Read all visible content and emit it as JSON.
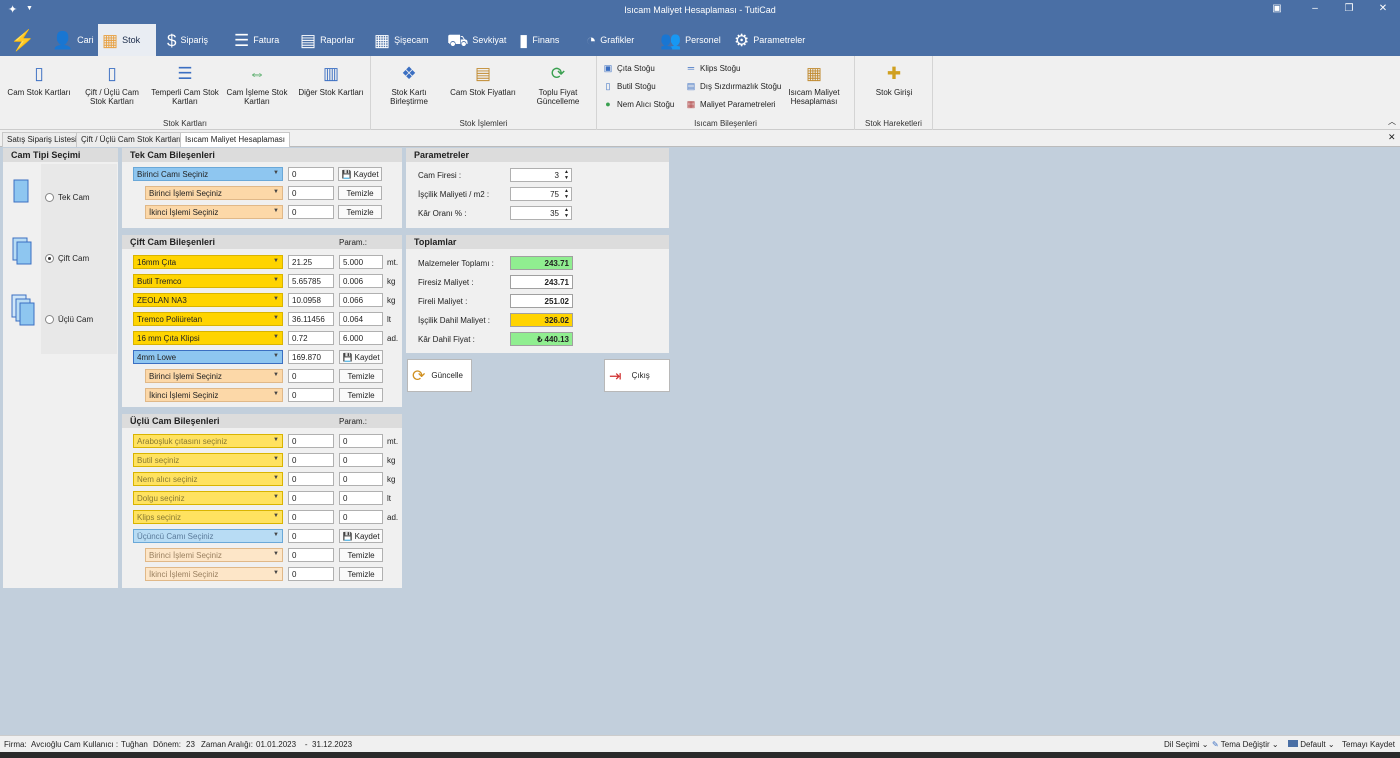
{
  "window": {
    "title": "Isıcam Maliyet Hesaplaması - TutiCad"
  },
  "menu": {
    "items": [
      {
        "label": "Cari",
        "icon": "user-icon"
      },
      {
        "label": "Stok",
        "icon": "box-icon"
      },
      {
        "label": "Sipariş",
        "icon": "order-icon"
      },
      {
        "label": "Fatura",
        "icon": "invoice-icon"
      },
      {
        "label": "Raporlar",
        "icon": "report-icon"
      },
      {
        "label": "Şişecam",
        "icon": "grid-icon"
      },
      {
        "label": "Sevkiyat",
        "icon": "truck-icon"
      },
      {
        "label": "Finans",
        "icon": "bar-chart-icon"
      },
      {
        "label": "Grafikler",
        "icon": "pie-chart-icon"
      },
      {
        "label": "Personel",
        "icon": "people-icon"
      },
      {
        "label": "Parametreler",
        "icon": "gear-icon"
      }
    ]
  },
  "ribbon": {
    "stok_kartlari": {
      "title": "Stok Kartları",
      "buttons": [
        "Cam Stok Kartları",
        "Çift / Üçlü Cam Stok Kartları",
        "Temperli Cam Stok Kartları",
        "Cam İşleme Stok Kartları",
        "Diğer Stok Kartları"
      ]
    },
    "stok_islemleri": {
      "title": "Stok İşlemleri",
      "buttons": [
        "Stok Kartı Birleştirme",
        "Cam Stok Fiyatları",
        "Toplu Fiyat Güncelleme"
      ]
    },
    "isicam": {
      "title": "Isıcam Bileşenleri",
      "small_left": [
        "Çıta Stoğu",
        "Butil Stoğu",
        "Nem Alıcı Stoğu"
      ],
      "small_right": [
        "Klips Stoğu",
        "Dış Sızdırmazlık Stoğu",
        "Maliyet Parametreleri"
      ],
      "big": "Isıcam Maliyet Hesaplaması"
    },
    "stok_hareketleri": {
      "title": "Stok Hareketleri",
      "buttons": [
        "Stok Girişi"
      ]
    }
  },
  "tabs": [
    "Satış Sipariş Listesi",
    "Çift / Üçlü Cam Stok Kartları",
    "Isıcam Maliyet Hesaplaması"
  ],
  "cam_tipi": {
    "title": "Cam Tipi Seçimi",
    "options": [
      {
        "label": "Tek Cam",
        "selected": false
      },
      {
        "label": "Çift Cam",
        "selected": true
      },
      {
        "label": "Üçlü Cam",
        "selected": false
      }
    ]
  },
  "tek_cam": {
    "title": "Tek Cam Bileşenleri",
    "glass": {
      "combo": "Birinci Camı Seçiniz",
      "value": "0",
      "button": "Kaydet"
    },
    "process1": {
      "combo": "Birinci İşlemi Seçiniz",
      "value": "0",
      "button": "Temizle"
    },
    "process2": {
      "combo": "İkinci İşlemi Seçiniz",
      "value": "0",
      "button": "Temizle"
    }
  },
  "cift_cam": {
    "title": "Çift Cam Bileşenleri",
    "param_label": "Param.:",
    "rows": [
      {
        "combo": "16mm Çıta",
        "value": "21.25",
        "param": "5.000",
        "unit": "mt."
      },
      {
        "combo": "Butil Tremco",
        "value": "5.65785",
        "param": "0.006",
        "unit": "kg"
      },
      {
        "combo": "ZEOLAN NA3",
        "value": "10.0958",
        "param": "0.066",
        "unit": "kg"
      },
      {
        "combo": "Tremco Poliüretan",
        "value": "36.11456",
        "param": "0.064",
        "unit": "lt"
      },
      {
        "combo": "16 mm Çıta Klipsi",
        "value": "0.72",
        "param": "6.000",
        "unit": "ad."
      }
    ],
    "glass": {
      "combo": "4mm Lowe",
      "value": "169.870",
      "button": "Kaydet"
    },
    "process1": {
      "combo": "Birinci İşlemi Seçiniz",
      "value": "0",
      "button": "Temizle"
    },
    "process2": {
      "combo": "İkinci İşlemi Seçiniz",
      "value": "0",
      "button": "Temizle"
    }
  },
  "uclu_cam": {
    "title": "Üçlü Cam Bileşenleri",
    "param_label": "Param.:",
    "rows": [
      {
        "combo": "Araboşluk çıtasını seçiniz",
        "value": "0",
        "param": "0",
        "unit": "mt."
      },
      {
        "combo": "Butil seçiniz",
        "value": "0",
        "param": "0",
        "unit": "kg"
      },
      {
        "combo": "Nem alıcı seçiniz",
        "value": "0",
        "param": "0",
        "unit": "kg"
      },
      {
        "combo": "Dolgu seçiniz",
        "value": "0",
        "param": "0",
        "unit": "lt"
      },
      {
        "combo": "Klips seçiniz",
        "value": "0",
        "param": "0",
        "unit": "ad."
      }
    ],
    "glass": {
      "combo": "Üçüncü Camı Seçiniz",
      "value": "0",
      "button": "Kaydet"
    },
    "process1": {
      "combo": "Birinci İşlemi Seçiniz",
      "value": "0",
      "button": "Temizle"
    },
    "process2": {
      "combo": "İkinci İşlemi Seçiniz",
      "value": "0",
      "button": "Temizle"
    }
  },
  "parametreler": {
    "title": "Parametreler",
    "rows": [
      {
        "label": "Cam Firesi :",
        "value": "3"
      },
      {
        "label": "İşçilik Maliyeti / m2 :",
        "value": "75"
      },
      {
        "label": "Kâr Oranı % :",
        "value": "35"
      }
    ]
  },
  "toplamlar": {
    "title": "Toplamlar",
    "rows": [
      {
        "label": "Malzemeler Toplamı :",
        "value": "243.71"
      },
      {
        "label": "Firesiz Maliyet :",
        "value": "243.71"
      },
      {
        "label": "Fireli Maliyet :",
        "value": "251.02"
      },
      {
        "label": "İşçilik Dahil Maliyet :",
        "value": "326.02"
      },
      {
        "label": "Kâr Dahil Fiyat :",
        "value": "₺ 440.13"
      }
    ]
  },
  "actions": {
    "update": "Güncelle",
    "exit": "Çıkış"
  },
  "status": {
    "firma_label": "Firma:",
    "firma": "Avcıoğlu Cam",
    "kullanici_label": "Kullanıcı :",
    "kullanici": "Tuğhan",
    "donem_label": "Dönem:",
    "donem": "23",
    "zaman_label": "Zaman Aralığı:",
    "zaman": "01.01.2023    -  31.12.2023",
    "dil": "Dil Seçimi",
    "tema": "Tema Değiştir",
    "default": "Default",
    "kaydet": "Temayı Kaydet"
  },
  "colors": {
    "titlebar": "#4a6fa5",
    "yellow": "#ffd400",
    "blue": "#8ec6f0",
    "orange": "#fcd8a8",
    "green": "#90ee90"
  }
}
